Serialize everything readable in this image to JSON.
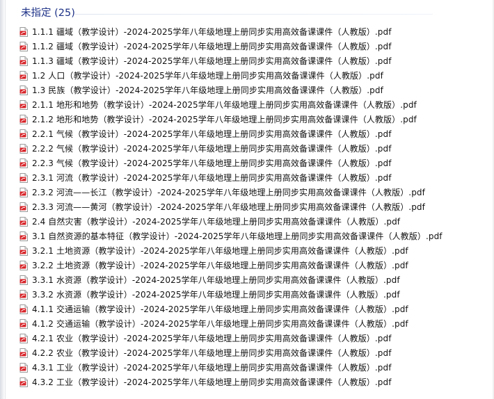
{
  "group": {
    "title": "未指定 (25)"
  },
  "colors": {
    "group_title": "#1e3287",
    "pdf_icon_red": "#d7262b"
  },
  "icons": {
    "file_icon": "pdf-file-icon"
  },
  "files": [
    {
      "name": "1.1.1 疆域（教学设计）-2024-2025学年八年级地理上册同步实用高效备课课件（人教版）.pdf"
    },
    {
      "name": "1.1.2 疆域（教学设计）-2024-2025学年八年级地理上册同步实用高效备课课件（人教版）.pdf"
    },
    {
      "name": "1.1.3 疆域（教学设计）-2024-2025学年八年级地理上册同步实用高效备课课件（人教版）.pdf"
    },
    {
      "name": "1.2 人口（教学设计）-2024-2025学年八年级地理上册同步实用高效备课课件（人教版）.pdf"
    },
    {
      "name": "1.3 民族（教学设计）-2024-2025学年八年级地理上册同步实用高效备课课件（人教版）.pdf"
    },
    {
      "name": "2.1.1 地形和地势（教学设计）-2024-2025学年八年级地理上册同步实用高效备课课件（人教版）.pdf"
    },
    {
      "name": "2.1.2 地形和地势（教学设计）-2024-2025学年八年级地理上册同步实用高效备课课件（人教版）.pdf"
    },
    {
      "name": "2.2.1 气候（教学设计）-2024-2025学年八年级地理上册同步实用高效备课课件（人教版）.pdf"
    },
    {
      "name": "2.2.2 气候（教学设计）-2024-2025学年八年级地理上册同步实用高效备课课件（人教版）.pdf"
    },
    {
      "name": "2.2.3 气候（教学设计）-2024-2025学年八年级地理上册同步实用高效备课课件（人教版）.pdf"
    },
    {
      "name": "2.3.1 河流（教学设计）-2024-2025学年八年级地理上册同步实用高效备课课件（人教版）.pdf"
    },
    {
      "name": "2.3.2 河流——长江（教学设计）-2024-2025学年八年级地理上册同步实用高效备课课件（人教版）.pdf"
    },
    {
      "name": "2.3.3 河流——黄河（教学设计）-2024-2025学年八年级地理上册同步实用高效备课课件（人教版）.pdf"
    },
    {
      "name": "2.4 自然灾害（教学设计）-2024-2025学年八年级地理上册同步实用高效备课课件（人教版）.pdf"
    },
    {
      "name": "3.1 自然资源的基本特征（教学设计）-2024-2025学年八年级地理上册同步实用高效备课课件（人教版）.pdf"
    },
    {
      "name": "3.2.1 土地资源（教学设计）-2024-2025学年八年级地理上册同步实用高效备课课件（人教版）.pdf"
    },
    {
      "name": "3.2.2 土地资源（教学设计）-2024-2025学年八年级地理上册同步实用高效备课课件（人教版）.pdf"
    },
    {
      "name": "3.3.1 水资源（教学设计）-2024-2025学年八年级地理上册同步实用高效备课课件（人教版）.pdf"
    },
    {
      "name": "3.3.2 水资源（教学设计）-2024-2025学年八年级地理上册同步实用高效备课课件（人教版）.pdf"
    },
    {
      "name": "4.1.1 交通运输（教学设计）-2024-2025学年八年级地理上册同步实用高效备课课件（人教版）.pdf"
    },
    {
      "name": "4.1.2 交通运输（教学设计）-2024-2025学年八年级地理上册同步实用高效备课课件（人教版）.pdf"
    },
    {
      "name": "4.2.1 农业（教学设计）-2024-2025学年八年级地理上册同步实用高效备课课件（人教版）.pdf"
    },
    {
      "name": "4.2.2 农业（教学设计）-2024-2025学年八年级地理上册同步实用高效备课课件（人教版）.pdf"
    },
    {
      "name": "4.3.1 工业（教学设计）-2024-2025学年八年级地理上册同步实用高效备课课件（人教版）.pdf"
    },
    {
      "name": "4.3.2 工业（教学设计）-2024-2025学年八年级地理上册同步实用高效备课课件（人教版）.pdf"
    }
  ]
}
